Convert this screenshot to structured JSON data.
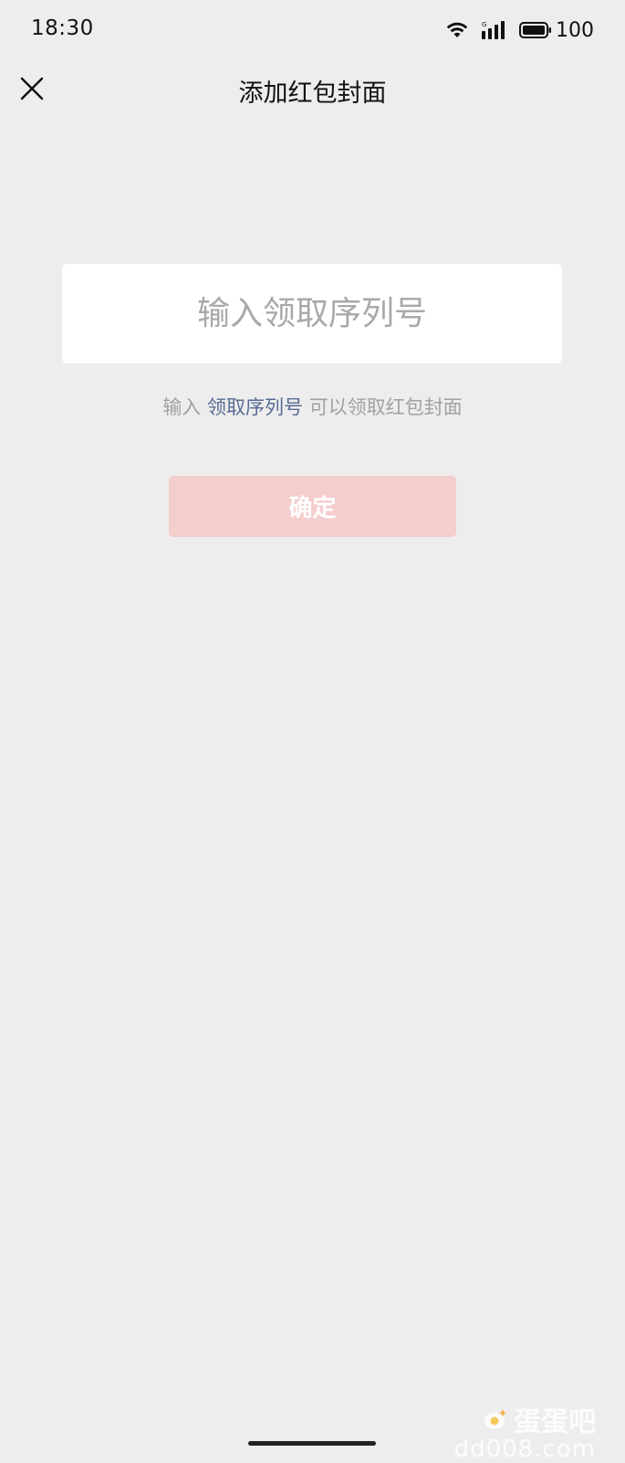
{
  "status_bar": {
    "time": "18:30",
    "battery_level": "100",
    "icons": [
      "wifi-icon",
      "signal-icon",
      "battery-icon"
    ]
  },
  "nav": {
    "title": "添加红包封面",
    "close_icon": "close-icon"
  },
  "serial_input": {
    "value": "",
    "placeholder": "输入领取序列号"
  },
  "hint": {
    "prefix": "输入",
    "link": "领取序列号",
    "suffix": "可以领取红包封面"
  },
  "confirm_button": {
    "label": "确定",
    "disabled": true
  },
  "colors": {
    "background": "#ededed",
    "link": "#576b95",
    "button_disabled": "#f4cdcd"
  },
  "watermark": {
    "brand": "蛋蛋吧",
    "domain": "dd008.com"
  }
}
